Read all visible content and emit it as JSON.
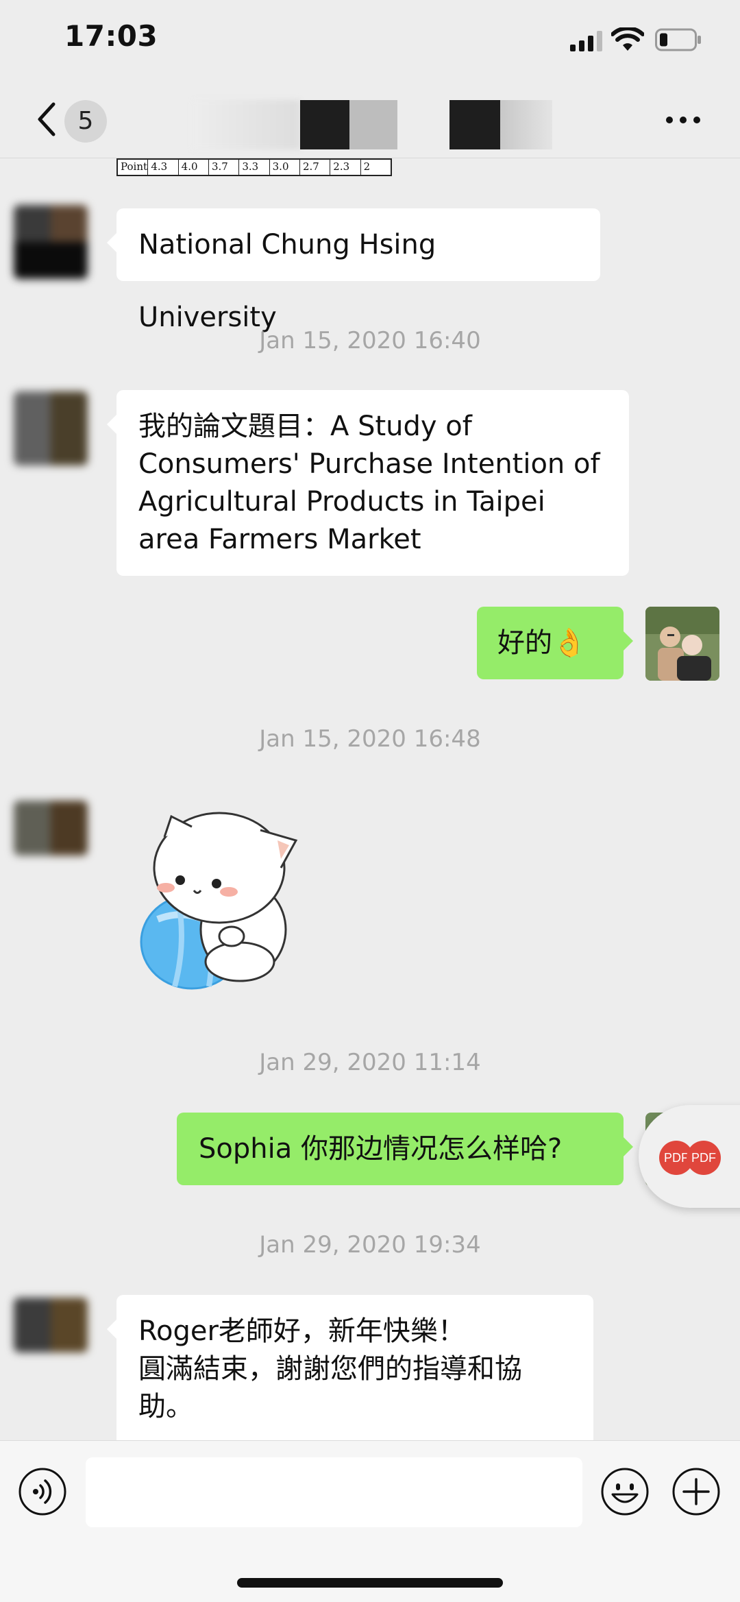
{
  "status_bar": {
    "time": "17:03"
  },
  "nav": {
    "unread_count": "5"
  },
  "table_fragment": [
    "Point",
    "4.3",
    "4.0",
    "3.7",
    "3.3",
    "3.0",
    "2.7",
    "2.3",
    "2"
  ],
  "messages": {
    "university": "National Chung Hsing University",
    "ts1": "Jan 15, 2020 16:40",
    "thesis_line1": "我的論文題目：A Study of",
    "thesis_line2": "Consumers' Purchase Intention of",
    "thesis_line3": "Agricultural Products in Taipei",
    "thesis_line4": "area Farmers Market",
    "ok_reply": "好的👌",
    "ts2": "Jan 15, 2020 16:48",
    "ts3": "Jan 29, 2020 11:14",
    "sophia_question": "Sophia 你那边情况怎么样哈?",
    "ts4": "Jan 29, 2020 19:34",
    "roger_line1": "Roger老師好，新年快樂！",
    "roger_line2": "圓滿結束，謝謝您們的指導和協",
    "roger_line3": "助。"
  },
  "pdf_badges": [
    "PDF",
    "PDF"
  ],
  "input": {
    "placeholder": ""
  },
  "colors": {
    "background": "#ededed",
    "incoming_bubble": "#ffffff",
    "outgoing_bubble": "#95ec69",
    "timestamp": "#a6a6a6"
  }
}
